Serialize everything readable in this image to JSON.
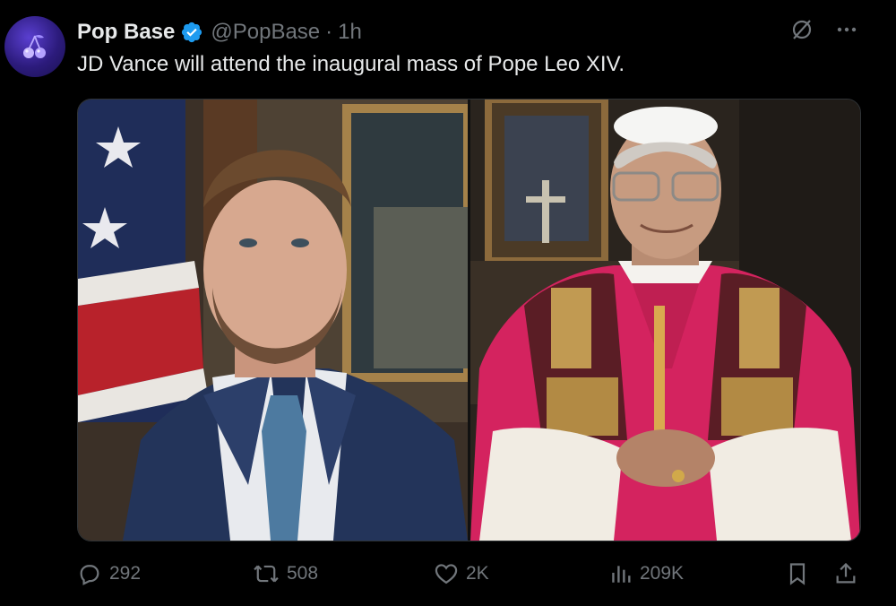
{
  "tweet": {
    "author_name": "Pop Base",
    "handle": "@PopBase",
    "separator": "·",
    "time": "1h",
    "text": "JD Vance will attend the inaugural mass of Pope Leo XIV."
  },
  "icons": {
    "avatar": "cherries-icon",
    "verified": "verified-badge-icon",
    "grok": "grok-icon",
    "more": "more-icon",
    "reply": "reply-icon",
    "retweet": "retweet-icon",
    "like": "heart-icon",
    "views": "views-icon",
    "bookmark": "bookmark-icon",
    "share": "share-icon"
  },
  "media": {
    "images": [
      {
        "subject": "man in navy suit beside US flag"
      },
      {
        "subject": "pope in red and gold vestments"
      }
    ]
  },
  "stats": {
    "replies": "292",
    "retweets": "508",
    "likes": "2K",
    "views": "209K"
  },
  "colors": {
    "background": "#000000",
    "text": "#e7e9ea",
    "muted": "#71767b",
    "verified": "#1d9bf0"
  }
}
